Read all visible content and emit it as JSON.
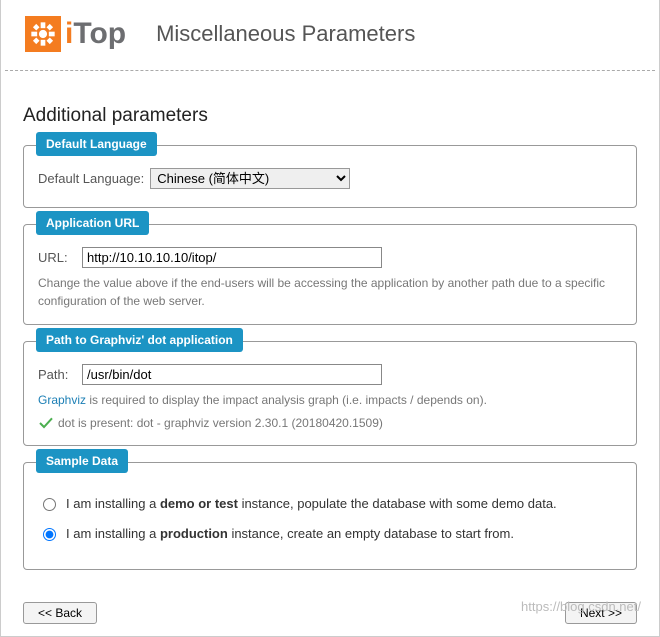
{
  "header": {
    "logo_text_i": "i",
    "logo_text_top": "Top",
    "title": "Miscellaneous Parameters"
  },
  "section_title": "Additional parameters",
  "lang_box": {
    "legend": "Default Language",
    "label": "Default Language:",
    "selected": "Chinese (简体中文)"
  },
  "url_box": {
    "legend": "Application URL",
    "label": "URL:",
    "value": "http://10.10.10.10/itop/",
    "hint": "Change the value above if the end-users will be accessing the application by another path due to a specific configuration of the web server."
  },
  "graphviz_box": {
    "legend": "Path to Graphviz' dot application",
    "label": "Path:",
    "value": "/usr/bin/dot",
    "hint_link": "Graphviz",
    "hint_rest": " is required to display the impact analysis graph (i.e. impacts / depends on).",
    "check_msg": "dot is present: dot - graphviz version 2.30.1 (20180420.1509)"
  },
  "sample_box": {
    "legend": "Sample Data",
    "option_demo_pre": "I am installing a ",
    "option_demo_bold": "demo or test",
    "option_demo_post": " instance, populate the database with some demo data.",
    "option_prod_pre": "I am installing a ",
    "option_prod_bold": "production",
    "option_prod_post": " instance, create an empty database to start from."
  },
  "footer": {
    "back": "<< Back",
    "next": "Next >>"
  },
  "watermark": "https://blog.csdn.net/"
}
